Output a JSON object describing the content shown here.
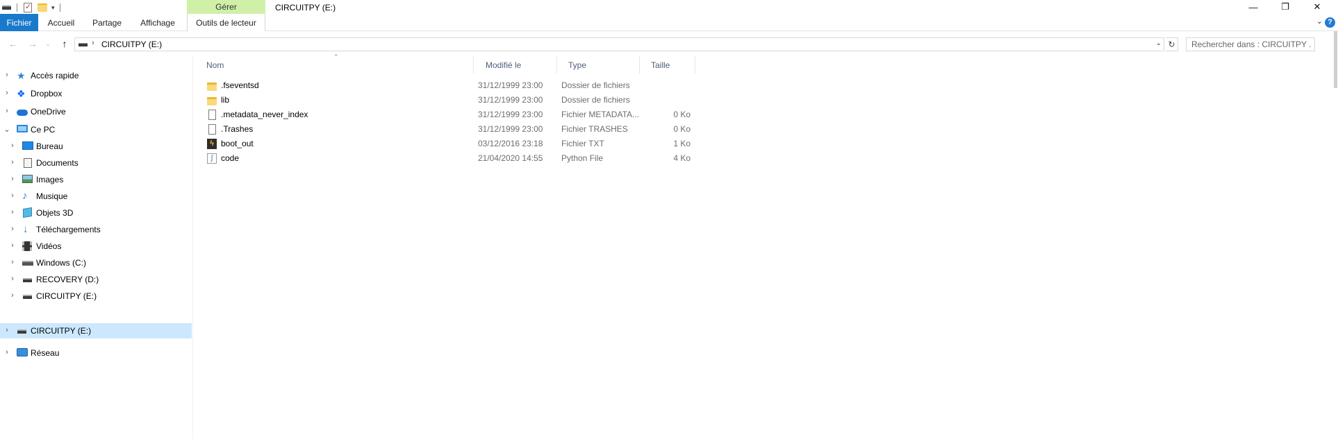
{
  "window": {
    "title": "CIRCUITPY (E:)",
    "context_tab_label": "Gérer",
    "minimize_glyph": "—",
    "maximize_glyph": "❐",
    "close_glyph": "✕"
  },
  "ribbon": {
    "tabs": [
      {
        "label": "Fichier",
        "active": true
      },
      {
        "label": "Accueil"
      },
      {
        "label": "Partage"
      },
      {
        "label": "Affichage"
      },
      {
        "label": "Outils de lecteur"
      }
    ],
    "help_glyph": "?"
  },
  "address_bar": {
    "path": "CIRCUITPY (E:)",
    "search_placeholder": "Rechercher dans : CIRCUITPY ..."
  },
  "nav_pane": {
    "items": [
      {
        "label": "Accès rapide",
        "icon": "star-icon"
      },
      {
        "label": "Dropbox",
        "icon": "dropbox-icon"
      },
      {
        "label": "OneDrive",
        "icon": "cloud-icon"
      },
      {
        "label": "Ce PC",
        "icon": "pc-icon",
        "expanded": true
      },
      {
        "label": "Bureau",
        "icon": "desktop-icon"
      },
      {
        "label": "Documents",
        "icon": "documents-icon"
      },
      {
        "label": "Images",
        "icon": "images-icon"
      },
      {
        "label": "Musique",
        "icon": "music-icon"
      },
      {
        "label": "Objets 3D",
        "icon": "3d-objects-icon"
      },
      {
        "label": "Téléchargements",
        "icon": "downloads-icon"
      },
      {
        "label": "Vidéos",
        "icon": "videos-icon"
      },
      {
        "label": "Windows (C:)",
        "icon": "windows-drive-icon"
      },
      {
        "label": "RECOVERY (D:)",
        "icon": "drive-icon"
      },
      {
        "label": "CIRCUITPY (E:)",
        "icon": "drive-icon"
      },
      {
        "label": "CIRCUITPY (E:)",
        "icon": "drive-icon",
        "selected": true
      },
      {
        "label": "Réseau",
        "icon": "network-icon"
      }
    ]
  },
  "file_list": {
    "columns": [
      "Nom",
      "Modifié le",
      "Type",
      "Taille"
    ],
    "rows": [
      {
        "name": ".fseventsd",
        "modified": "31/12/1999 23:00",
        "type": "Dossier de fichiers",
        "size": "",
        "icon": "folder-icon"
      },
      {
        "name": "lib",
        "modified": "31/12/1999 23:00",
        "type": "Dossier de fichiers",
        "size": "",
        "icon": "folder-icon"
      },
      {
        "name": ".metadata_never_index",
        "modified": "31/12/1999 23:00",
        "type": "Fichier METADATA...",
        "size": "0 Ko",
        "icon": "file-icon"
      },
      {
        "name": ".Trashes",
        "modified": "31/12/1999 23:00",
        "type": "Fichier TRASHES",
        "size": "0 Ko",
        "icon": "file-icon"
      },
      {
        "name": "boot_out",
        "modified": "03/12/2016 23:18",
        "type": "Fichier TXT",
        "size": "1 Ko",
        "icon": "text-file-icon"
      },
      {
        "name": "code",
        "modified": "21/04/2020 14:55",
        "type": "Python File",
        "size": "4 Ko",
        "icon": "python-file-icon"
      }
    ]
  },
  "colors": {
    "accent": "#1979ca",
    "context_tab": "#d0f0a8",
    "selection": "#cce8ff",
    "folder": "#f9d979"
  }
}
